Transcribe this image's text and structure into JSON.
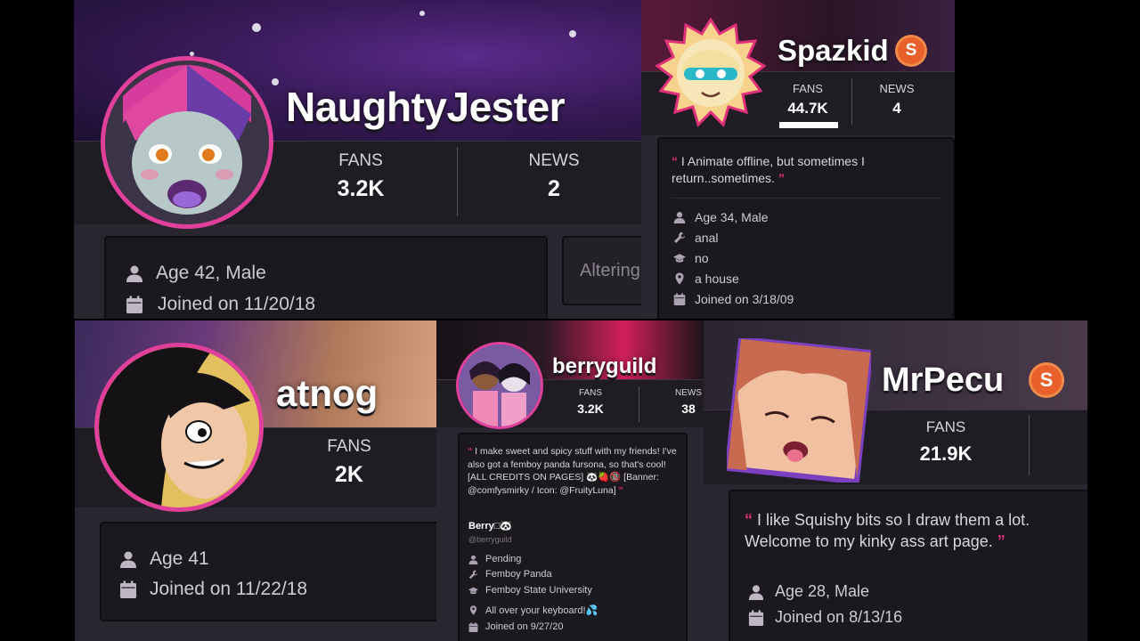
{
  "colors": {
    "page_bg": "#000000",
    "panel_bg": "#2a2630",
    "card_bg": "#1b181e",
    "accent_pink": "#e0307a",
    "badge_orange": "#e8602c",
    "banner_purple": "#3a1b5a"
  },
  "panels": {
    "naughtyjester": {
      "username": "NaughtyJester",
      "fans_label": "FANS",
      "fans_value": "3.2K",
      "news_label": "NEWS",
      "news_value": "2",
      "age": "Age 42, Male",
      "joined": "Joined on 11/20/18",
      "side_card_text": "Altering"
    },
    "spazkid": {
      "username": "Spazkid",
      "badge": "S",
      "fans_label": "FANS",
      "fans_value": "44.7K",
      "news_label": "NEWS",
      "news_value": "4",
      "quote": "I Animate offline, but sometimes I return..sometimes.",
      "age": "Age 34, Male",
      "job": "anal",
      "school": "no",
      "location": "a house",
      "joined": "Joined on 3/18/09"
    },
    "atnog": {
      "username": "atnog",
      "fans_label": "FANS",
      "fans_value": "2K",
      "age": "Age 41",
      "joined": "Joined on 11/22/18"
    },
    "berryguild": {
      "username": "berryguild",
      "fans_label": "FANS",
      "fans_value": "3.2K",
      "news_label": "NEWS",
      "news_value": "38",
      "quote": "I make sweet and spicy stuff with my friends! I've also got a femboy panda fursona, so that's cool! [ALL CREDITS ON PAGES] 🐼🍓🔞 [Banner: @comfysmirky / Icon: @FruityLuna]",
      "name": "Berry□🐼",
      "handle": "@berryguild",
      "status": "Pending",
      "job": "Femboy Panda",
      "school": "Femboy State University",
      "location": "All over your keyboard!💦",
      "joined": "Joined on 9/27/20"
    },
    "mrpecu": {
      "username": "MrPecu",
      "badge": "S",
      "fans_label": "FANS",
      "fans_value": "21.9K",
      "quote": "I like Squishy bits so I draw them a lot. Welcome to my kinky ass art page.",
      "age": "Age 28, Male",
      "joined": "Joined on 8/13/16"
    }
  },
  "icons": [
    "user-icon",
    "calendar-icon",
    "wrench-icon",
    "graduation-cap-icon",
    "map-pin-icon",
    "supporter-badge-icon"
  ]
}
